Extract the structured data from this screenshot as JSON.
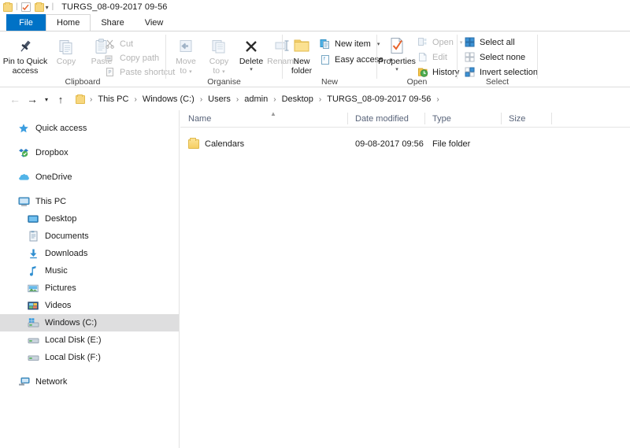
{
  "window": {
    "title": "TURGS_08-09-2017 09-56",
    "quick_access_icons": [
      "folder-icon",
      "properties-check-icon",
      "new-folder-icon"
    ],
    "customize_caret": "▾"
  },
  "tabs": [
    {
      "label": "File",
      "id": "file"
    },
    {
      "label": "Home",
      "id": "home"
    },
    {
      "label": "Share",
      "id": "share"
    },
    {
      "label": "View",
      "id": "view"
    }
  ],
  "ribbon": {
    "groups": [
      {
        "label": "Clipboard",
        "big_buttons": [
          {
            "label": "Pin to Quick\naccess",
            "line1": "Pin to Quick",
            "line2": "access",
            "icon": "pin-icon",
            "disabled": false
          },
          {
            "label": "Copy",
            "line1": "Copy",
            "line2": "",
            "icon": "copy-icon",
            "disabled": true
          },
          {
            "label": "Paste",
            "line1": "Paste",
            "line2": "",
            "icon": "paste-icon",
            "disabled": true
          }
        ],
        "small_buttons": [
          {
            "label": "Cut",
            "icon": "scissors-icon",
            "disabled": true
          },
          {
            "label": "Copy path",
            "icon": "copy-path-icon",
            "disabled": true
          },
          {
            "label": "Paste shortcut",
            "icon": "paste-shortcut-icon",
            "disabled": true
          }
        ]
      },
      {
        "label": "Organise",
        "big_buttons": [
          {
            "line1": "Move",
            "line2": "to",
            "icon": "move-to-icon",
            "disabled": true,
            "caret": "▾"
          },
          {
            "line1": "Copy",
            "line2": "to",
            "icon": "copy-to-icon",
            "disabled": true,
            "caret": "▾"
          },
          {
            "line1": "Delete",
            "line2": "",
            "icon": "delete-x-icon",
            "disabled": false,
            "caret": "▾"
          },
          {
            "line1": "Rename",
            "line2": "",
            "icon": "rename-icon",
            "disabled": true
          }
        ],
        "small_buttons": []
      },
      {
        "label": "New",
        "big_buttons": [
          {
            "line1": "New",
            "line2": "folder",
            "icon": "new-folder-icon",
            "disabled": false
          }
        ],
        "small_buttons": [
          {
            "label": "New item",
            "icon": "new-item-icon",
            "disabled": false,
            "caret": "▾"
          },
          {
            "label": "Easy access",
            "icon": "easy-access-icon",
            "disabled": false,
            "caret": "▾"
          }
        ]
      },
      {
        "label": "Open",
        "big_buttons": [
          {
            "line1": "Properties",
            "line2": "",
            "icon": "properties-icon",
            "disabled": false,
            "caret": "▾"
          }
        ],
        "small_buttons": [
          {
            "label": "Open",
            "icon": "open-icon",
            "disabled": true,
            "caret": "▾"
          },
          {
            "label": "Edit",
            "icon": "edit-icon",
            "disabled": true
          },
          {
            "label": "History",
            "icon": "history-icon",
            "disabled": false
          }
        ]
      },
      {
        "label": "Select",
        "big_buttons": [],
        "small_buttons": [
          {
            "label": "Select all",
            "icon": "select-all-icon",
            "disabled": false
          },
          {
            "label": "Select none",
            "icon": "select-none-icon",
            "disabled": false
          },
          {
            "label": "Invert selection",
            "icon": "invert-selection-icon",
            "disabled": false
          }
        ]
      }
    ]
  },
  "address_bar": {
    "back": "←",
    "forward": "→",
    "recent": "▾",
    "up": "↑",
    "crumb_separator": "›",
    "crumbs": [
      "This PC",
      "Windows (C:)",
      "Users",
      "admin",
      "Desktop",
      "TURGS_08-09-2017 09-56"
    ]
  },
  "sidebar": {
    "items": [
      {
        "label": "Quick access",
        "icon": "star-icon",
        "level": 0,
        "selected": false,
        "gap_after": true
      },
      {
        "label": "Dropbox",
        "icon": "dropbox-icon",
        "level": 0,
        "selected": false,
        "gap_after": true
      },
      {
        "label": "OneDrive",
        "icon": "cloud-icon",
        "level": 0,
        "selected": false,
        "gap_after": true
      },
      {
        "label": "This PC",
        "icon": "monitor-icon",
        "level": 0,
        "selected": false,
        "gap_after": false
      },
      {
        "label": "Desktop",
        "icon": "desktop-icon",
        "level": 1,
        "selected": false,
        "gap_after": false
      },
      {
        "label": "Documents",
        "icon": "documents-icon",
        "level": 1,
        "selected": false,
        "gap_after": false
      },
      {
        "label": "Downloads",
        "icon": "downloads-icon",
        "level": 1,
        "selected": false,
        "gap_after": false
      },
      {
        "label": "Music",
        "icon": "music-note-icon",
        "level": 1,
        "selected": false,
        "gap_after": false
      },
      {
        "label": "Pictures",
        "icon": "pictures-icon",
        "level": 1,
        "selected": false,
        "gap_after": false
      },
      {
        "label": "Videos",
        "icon": "videos-icon",
        "level": 1,
        "selected": false,
        "gap_after": false
      },
      {
        "label": "Windows (C:)",
        "icon": "windows-drive-icon",
        "level": 1,
        "selected": true,
        "gap_after": false
      },
      {
        "label": "Local Disk (E:)",
        "icon": "drive-icon",
        "level": 1,
        "selected": false,
        "gap_after": false
      },
      {
        "label": "Local Disk (F:)",
        "icon": "drive-icon",
        "level": 1,
        "selected": false,
        "gap_after": true
      },
      {
        "label": "Network",
        "icon": "network-icon",
        "level": 0,
        "selected": false,
        "gap_after": false
      }
    ]
  },
  "file_list": {
    "columns": [
      {
        "label": "Name",
        "sorted": "asc",
        "sort_glyph": "▲"
      },
      {
        "label": "Date modified",
        "sorted": "",
        "sort_glyph": ""
      },
      {
        "label": "Type",
        "sorted": "",
        "sort_glyph": ""
      },
      {
        "label": "Size",
        "sorted": "",
        "sort_glyph": ""
      }
    ],
    "rows": [
      {
        "name": "Calendars",
        "date_modified": "09-08-2017 09:56",
        "type": "File folder",
        "size": "",
        "icon": "folder-icon"
      }
    ]
  },
  "colors": {
    "accent": "#0072c6",
    "folder": "#f6cf63",
    "selection": "#dededf",
    "header_text": "#59647a"
  }
}
